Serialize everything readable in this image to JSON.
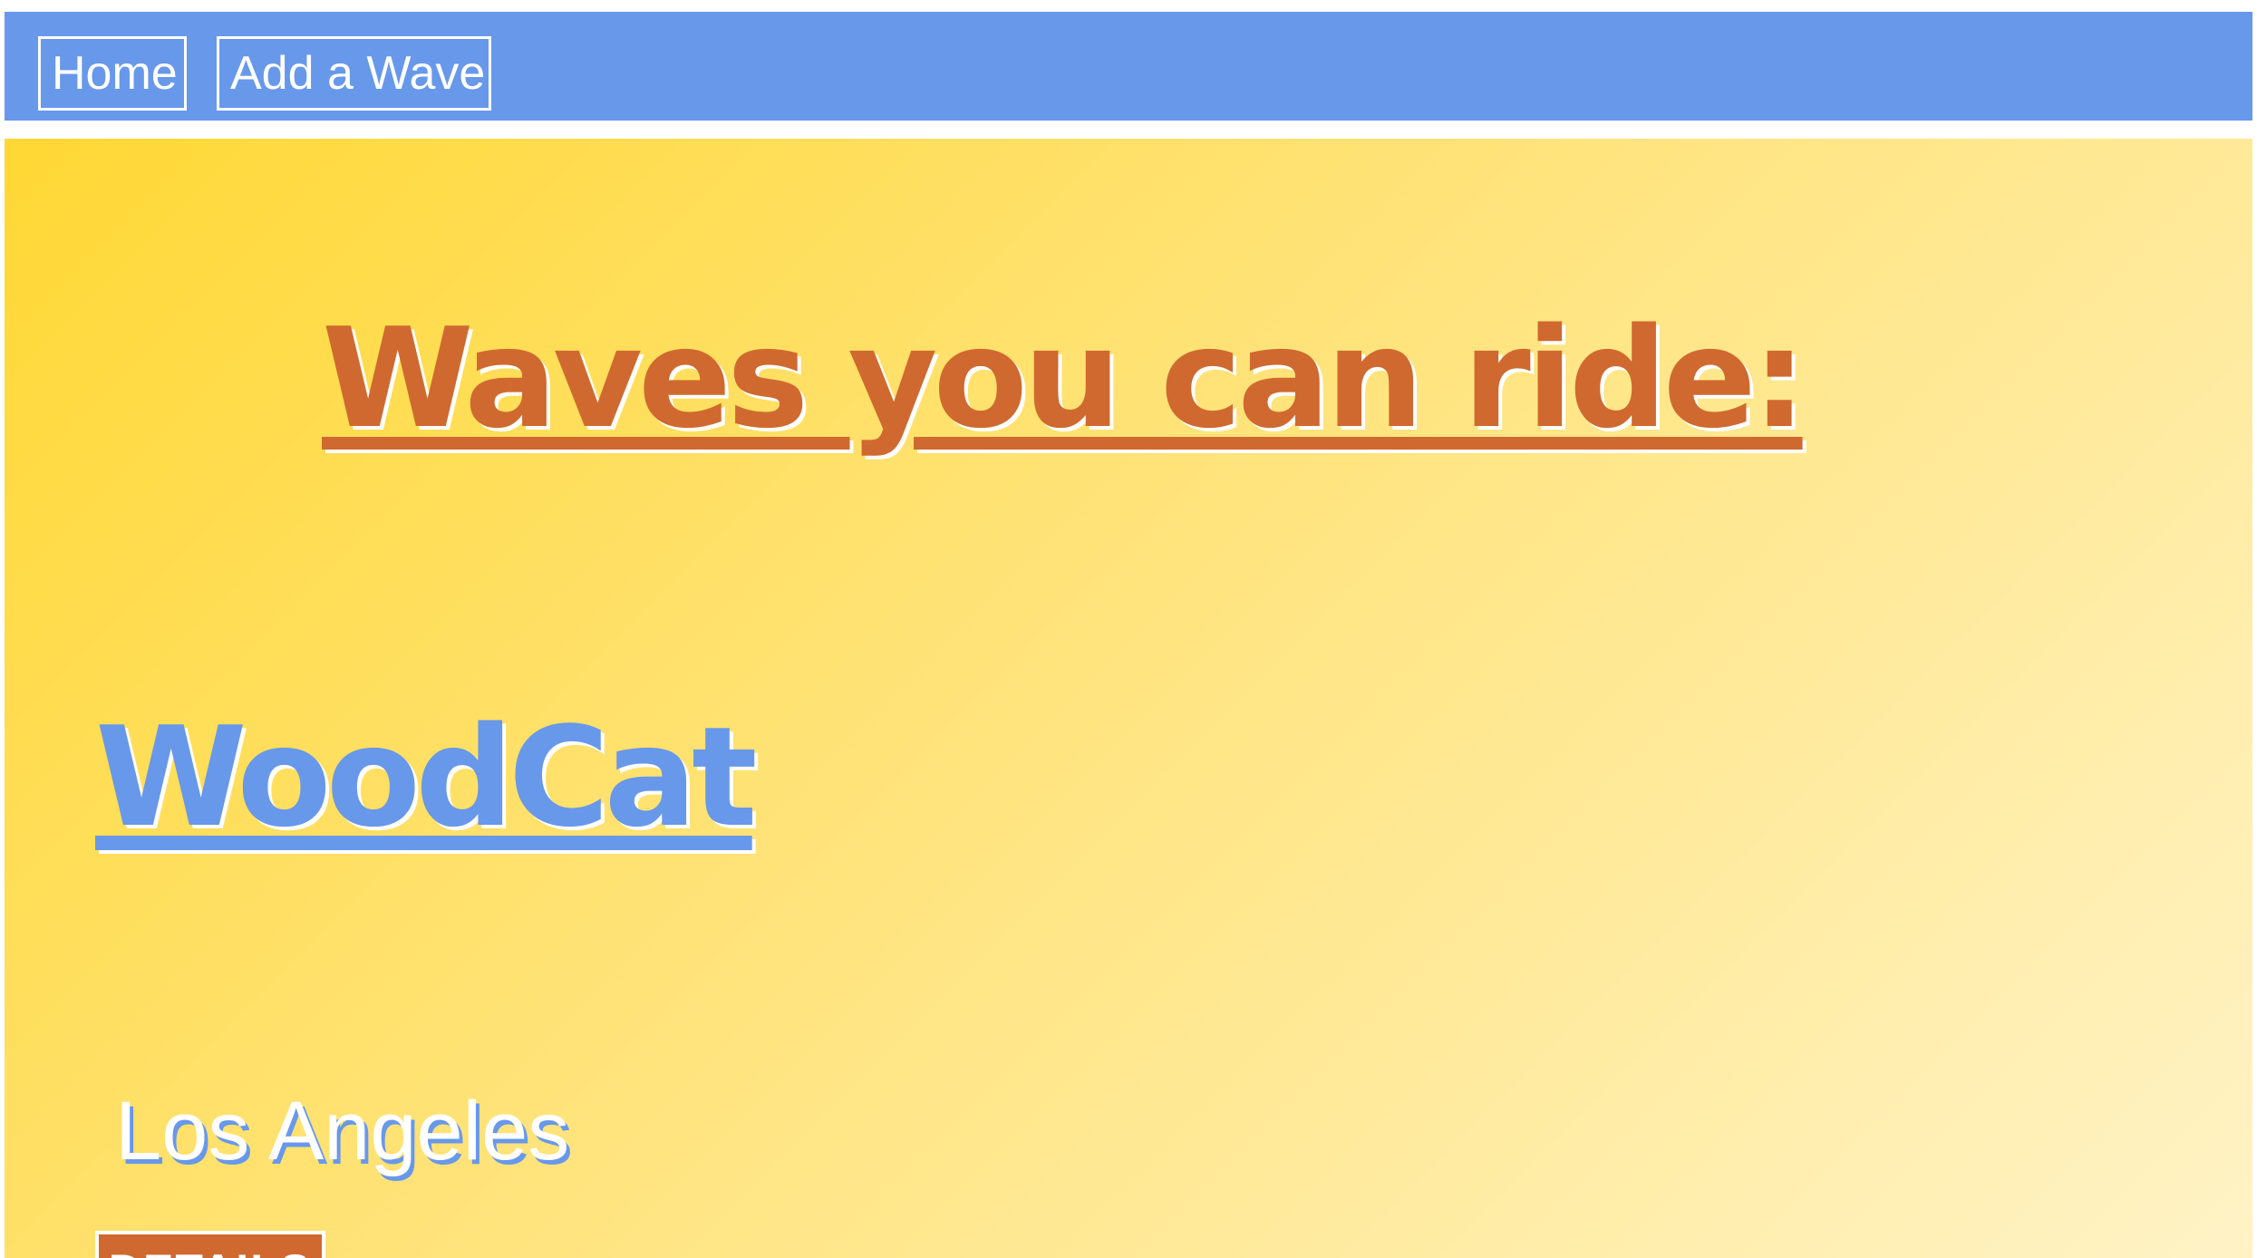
{
  "nav": {
    "home_label": "Home",
    "add_wave_label": "Add a Wave"
  },
  "main": {
    "title": "Waves you can ride:",
    "waves": [
      {
        "name": "WoodCat",
        "location": "Los Angeles",
        "details_label": "DETAILS"
      }
    ]
  },
  "colors": {
    "nav_background": "#6898ea",
    "accent_orange": "#d0692f",
    "accent_blue": "#6898ea",
    "gradient_start": "#ffd834",
    "gradient_end": "#fff3c6"
  }
}
